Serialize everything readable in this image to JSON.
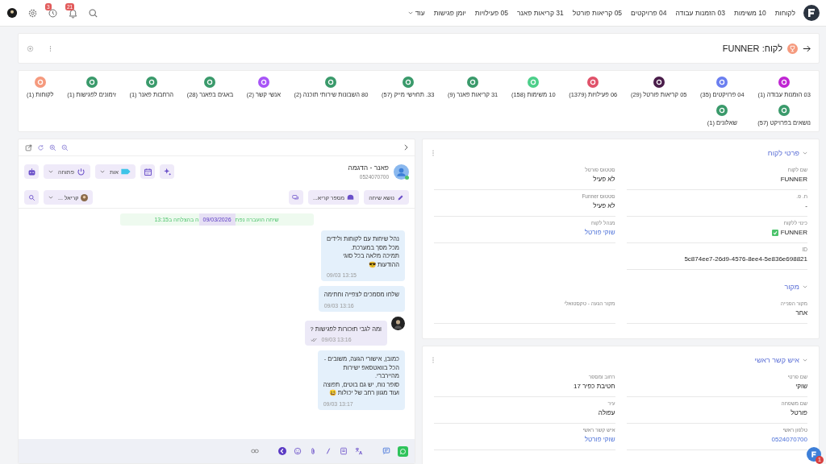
{
  "nav": {
    "items": [
      "לקוחות",
      "10 משימות",
      "03 הזמנות עבודה",
      "04 פרויקטים",
      "05 קריאות פורטל",
      "31 קריאות פאנר",
      "05 פעילויות",
      "יומן פגישות"
    ],
    "more": "עוד",
    "notifications_badge": "21",
    "reminders_badge": "3"
  },
  "header": {
    "title": "לקוח: FUNNER"
  },
  "tiles": [
    {
      "label": "03 הזמנות עבודה (1)",
      "color": "#c026d3"
    },
    {
      "label": "04 פרויקטים (35)",
      "color": "#6b7ff0"
    },
    {
      "label": "05 קריאות פורטל (29)",
      "color": "#4a1d4a"
    },
    {
      "label": "06 פעילויות (1379)",
      "color": "#e0526a"
    },
    {
      "label": "10 משימות (158)",
      "color": "#4ccf8a"
    },
    {
      "label": "31 קריאות פאנר (9)",
      "color": "#3a9a6b"
    },
    {
      "label": "33. תחזישי מייק (57)",
      "color": "#3a9a6b"
    },
    {
      "label": "80 השבונות שירותי תוכנה (2)",
      "color": "#3a9a6b"
    },
    {
      "label": "אנשי קשר (2)",
      "color": "#a855f7"
    },
    {
      "label": "באגים בפאנר (28)",
      "color": "#3a9a6b"
    },
    {
      "label": "הרחבות פאנר (1)",
      "color": "#3a9a6b"
    },
    {
      "label": "זימונים לפגישות (1)",
      "color": "#3a9a6b"
    },
    {
      "label": "לקוחות (1)",
      "color": "#f59a7e"
    },
    {
      "label": "נושאים בפרויקט (57)",
      "color": "#3a9a6b"
    },
    {
      "label": "שאלונים (1)",
      "color": "#3a9a6b"
    }
  ],
  "chat": {
    "contact_name": "פאנר - הדגמה",
    "contact_phone": "0524070700",
    "online": true,
    "tag_label": "אות",
    "status_label": "פתוחה",
    "topic_button": "נושא שיחה",
    "ticket_button": "מספר קריא...",
    "agent": "קריאל ...",
    "system_note": [
      "שיחה הועברה נפת",
      "ה בהצלחה ב13:15"
    ],
    "date_chip": "09/03/2026",
    "messages": [
      {
        "kind": "outgoing",
        "lines": [
          "נהל שיחות עם לקוחות ולידים",
          "מכל מסך במערכת.",
          "תמיכה מלאה בכל סוגי",
          "ההודעות 😎"
        ],
        "time": "13:15 09/03"
      },
      {
        "kind": "outgoing",
        "lines": [
          "שלחו מסמכים לצפייה וחתימה"
        ],
        "time": "13:16 09/03"
      },
      {
        "kind": "incoming",
        "lines": [
          "ומה לגבי תזכורות לפגישות ?"
        ],
        "time": "13:16 09/03",
        "read": true
      },
      {
        "kind": "outgoing",
        "lines": [
          "כמובן, אישורי הגעה, משובים -",
          "הכל בוואטסאפ ישירות",
          "מהיירברי.",
          "סופר נוח, יש גם בוטים, תפוצה",
          "ועוד מגוון רחב של יכולות 😆"
        ],
        "time": "13:17 09/03"
      }
    ]
  },
  "cards": [
    {
      "title": "פרטי לקוח",
      "expanded": true,
      "sections": [
        {
          "fields": [
            {
              "label": "שם לקוח",
              "value": "FUNNER",
              "kind": "text"
            },
            {
              "label": "סטטוס פורטל",
              "value": "לא פעיל",
              "kind": "text"
            },
            {
              "label": "ח. פ.",
              "value": "-",
              "kind": "text"
            },
            {
              "label": "סטטוס Funner",
              "value": "לא פעיל",
              "kind": "text"
            },
            {
              "label": "כינוי ללקוח",
              "value": "FUNNER",
              "kind": "check"
            },
            {
              "label": "מנהל לקוח",
              "value": "שוקי פורטל",
              "kind": "link"
            },
            {
              "label": "ID",
              "value": "5c874ee7-26d9-4576-8ee4-5e836e698821",
              "kind": "text"
            }
          ]
        },
        {
          "title": "מקור",
          "expanded": true,
          "fields": [
            {
              "label": "מקור הפנייה",
              "value": "אחר",
              "kind": "text"
            },
            {
              "label": "מקור הגעה - טקסטואלי"
            }
          ]
        }
      ]
    },
    {
      "title": "איש קשר ראשי",
      "expanded": true,
      "sections": [
        {
          "fields": [
            {
              "label": "שם פרטי",
              "value": "שוקי",
              "kind": "text"
            },
            {
              "label": "רחוב ומספר",
              "value": "חטיבת כפיר 17",
              "kind": "text"
            },
            {
              "label": "שם משפחה",
              "value": "פורטל",
              "kind": "text"
            },
            {
              "label": "עיר",
              "value": "עפולה",
              "kind": "text"
            },
            {
              "label": "טלפון ראשי",
              "value": "0524070700",
              "kind": "link"
            },
            {
              "label": "איש קשר ראשי",
              "value": "שוקי פורטל",
              "kind": "link"
            }
          ]
        }
      ]
    }
  ],
  "help_badge": "1"
}
